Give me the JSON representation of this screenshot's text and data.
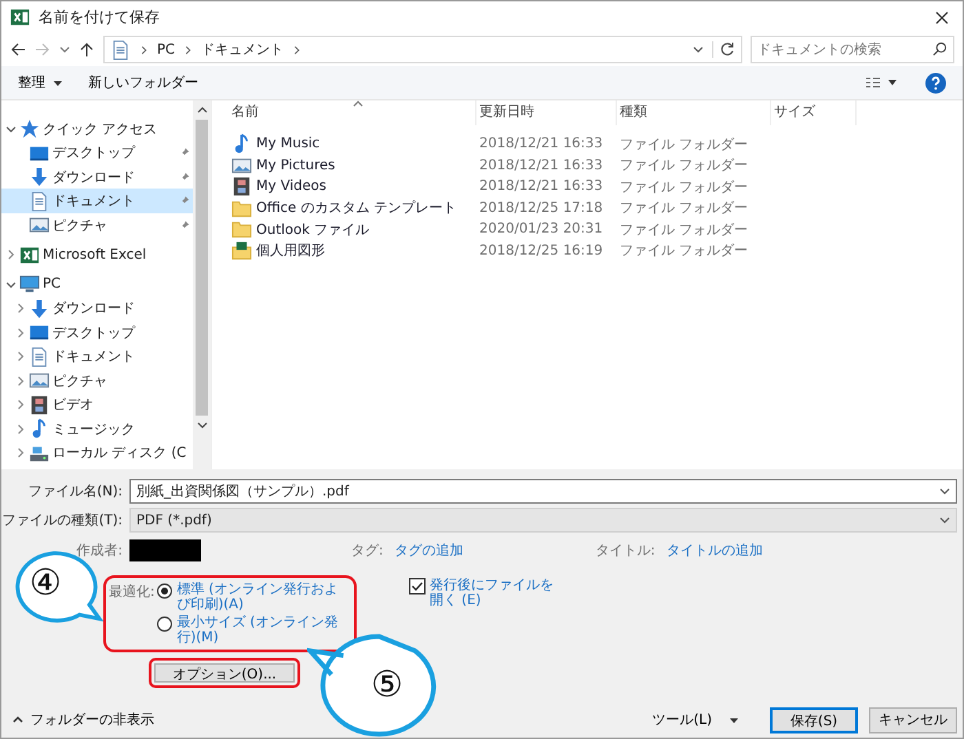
{
  "window": {
    "title": "名前を付けて保存"
  },
  "nav": {
    "path": [
      "PC",
      "ドキュメント"
    ]
  },
  "search": {
    "placeholder": "ドキュメントの検索"
  },
  "toolbar": {
    "organize": "整理",
    "new_folder": "新しいフォルダー"
  },
  "sidebar": {
    "items": [
      {
        "label": "クイック アクセス",
        "kind": "star",
        "expanded": true,
        "children": [
          {
            "label": "デスクトップ",
            "kind": "desktop",
            "pinned": true,
            "selected": false
          },
          {
            "label": "ダウンロード",
            "kind": "download",
            "pinned": true,
            "selected": false
          },
          {
            "label": "ドキュメント",
            "kind": "document",
            "pinned": true,
            "selected": true
          },
          {
            "label": "ピクチャ",
            "kind": "pictures",
            "pinned": true,
            "selected": false
          }
        ]
      },
      {
        "label": "Microsoft Excel",
        "kind": "excel",
        "expanded": false
      },
      {
        "label": "PC",
        "kind": "pc",
        "expanded": true,
        "children": [
          {
            "label": "ダウンロード",
            "kind": "download",
            "expanded": false,
            "selected": false
          },
          {
            "label": "デスクトップ",
            "kind": "desktop",
            "expanded": false,
            "selected": false
          },
          {
            "label": "ドキュメント",
            "kind": "document",
            "expanded": false,
            "selected": false
          },
          {
            "label": "ピクチャ",
            "kind": "pictures",
            "expanded": false,
            "selected": false
          },
          {
            "label": "ビデオ",
            "kind": "video",
            "expanded": false,
            "selected": false
          },
          {
            "label": "ミュージック",
            "kind": "music",
            "expanded": false,
            "selected": false
          },
          {
            "label": "ローカル ディスク (C",
            "kind": "disk",
            "expanded": false,
            "selected": false
          }
        ]
      }
    ]
  },
  "table": {
    "columns": [
      "名前",
      "更新日時",
      "種類",
      "サイズ"
    ],
    "rows": [
      {
        "name": "My Music",
        "modified": "2018/12/21 16:33",
        "type": "ファイル フォルダー",
        "kind": "music"
      },
      {
        "name": "My Pictures",
        "modified": "2018/12/21 16:33",
        "type": "ファイル フォルダー",
        "kind": "pictures"
      },
      {
        "name": "My Videos",
        "modified": "2018/12/21 16:33",
        "type": "ファイル フォルダー",
        "kind": "video"
      },
      {
        "name": "Office のカスタム テンプレート",
        "modified": "2018/12/25 17:18",
        "type": "ファイル フォルダー",
        "kind": "folder"
      },
      {
        "name": "Outlook ファイル",
        "modified": "2020/01/23 20:31",
        "type": "ファイル フォルダー",
        "kind": "folder"
      },
      {
        "name": "個人用図形",
        "modified": "2018/12/25 16:19",
        "type": "ファイル フォルダー",
        "kind": "excel-folder"
      }
    ]
  },
  "form": {
    "file_name": {
      "label": "ファイル名(N):",
      "value": "別紙_出資関係図（サンプル）.pdf"
    },
    "file_type": {
      "label": "ファイルの種類(T):",
      "value": "PDF (*.pdf)"
    },
    "author": {
      "label": "作成者:"
    },
    "tags": {
      "label": "タグ:",
      "value": "タグの追加"
    },
    "title": {
      "label": "タイトル:",
      "value": "タイトルの追加"
    },
    "optimize": {
      "label": "最適化:",
      "options": [
        {
          "label": "標準 (オンライン発行および印刷)(A)",
          "selected": true
        },
        {
          "label": "最小サイズ (オンライン発行)(M)",
          "selected": false
        }
      ]
    },
    "open_after": {
      "label": "発行後にファイルを開く (E)",
      "checked": true
    },
    "options_button": "オプション(O)..."
  },
  "footer": {
    "hide_folders": "フォルダーの非表示",
    "tools": "ツール(L)",
    "save": "保存(S)",
    "cancel": "キャンセル"
  },
  "callouts": [
    "④",
    "⑤"
  ]
}
